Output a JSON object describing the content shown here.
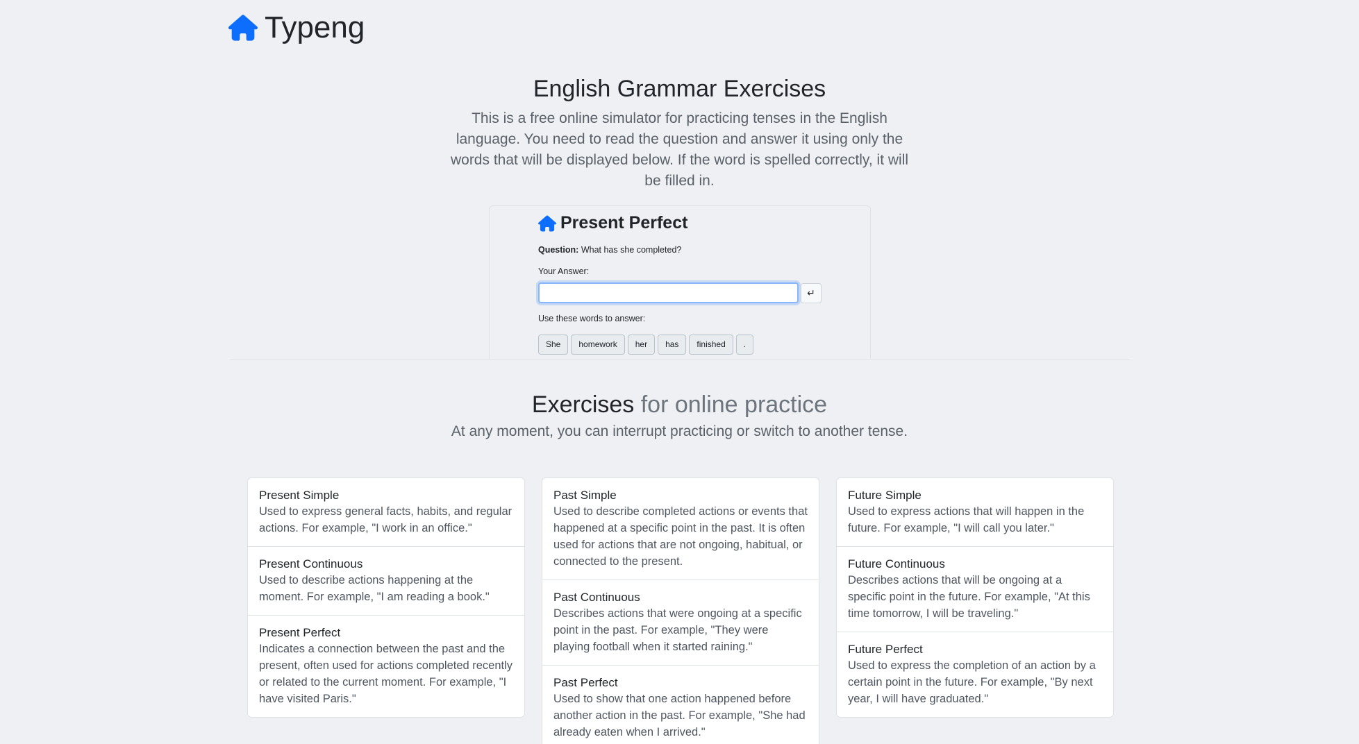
{
  "brand": {
    "name": "Typeng",
    "icon": "house-icon",
    "color": "#0d6efd"
  },
  "hero": {
    "title": "English Grammar Exercises",
    "lead": "This is a free online simulator for practicing tenses in the English language. You need to read the question and answer it using only the words that will be displayed below. If the word is spelled correctly, it will be filled in."
  },
  "demo": {
    "title": "Present Perfect",
    "question_label": "Question:",
    "question_text": " What has she completed?",
    "answer_label": "Your Answer:",
    "answer_value": "",
    "enter_symbol": "↵",
    "words_label": "Use these words to answer:",
    "words": [
      "She",
      "homework",
      "her",
      "has",
      "finished",
      "."
    ]
  },
  "exercises": {
    "title_main": "Exercises",
    "title_muted": " for online practice",
    "subtitle": "At any moment, you can interrupt practicing or switch to another tense.",
    "columns": [
      [
        {
          "title": "Present Simple",
          "desc": "Used to express general facts, habits, and regular actions. For example, \"I work in an office.\""
        },
        {
          "title": "Present Continuous",
          "desc": "Used to describe actions happening at the moment. For example, \"I am reading a book.\""
        },
        {
          "title": "Present Perfect",
          "desc": "Indicates a connection between the past and the present, often used for actions completed recently or related to the current moment. For example, \"I have visited Paris.\""
        }
      ],
      [
        {
          "title": "Past Simple",
          "desc": "Used to describe completed actions or events that happened at a specific point in the past. It is often used for actions that are not ongoing, habitual, or connected to the present."
        },
        {
          "title": "Past Continuous",
          "desc": "Describes actions that were ongoing at a specific point in the past. For example, \"They were playing football when it started raining.\""
        },
        {
          "title": "Past Perfect",
          "desc": "Used to show that one action happened before another action in the past. For example, \"She had already eaten when I arrived.\""
        }
      ],
      [
        {
          "title": "Future Simple",
          "desc": "Used to express actions that will happen in the future. For example, \"I will call you later.\""
        },
        {
          "title": "Future Continuous",
          "desc": "Describes actions that will be ongoing at a specific point in the future. For example, \"At this time tomorrow, I will be traveling.\""
        },
        {
          "title": "Future Perfect",
          "desc": "Used to express the completion of an action by a certain point in the future. For example, \"By next year, I will have graduated.\""
        }
      ]
    ]
  }
}
